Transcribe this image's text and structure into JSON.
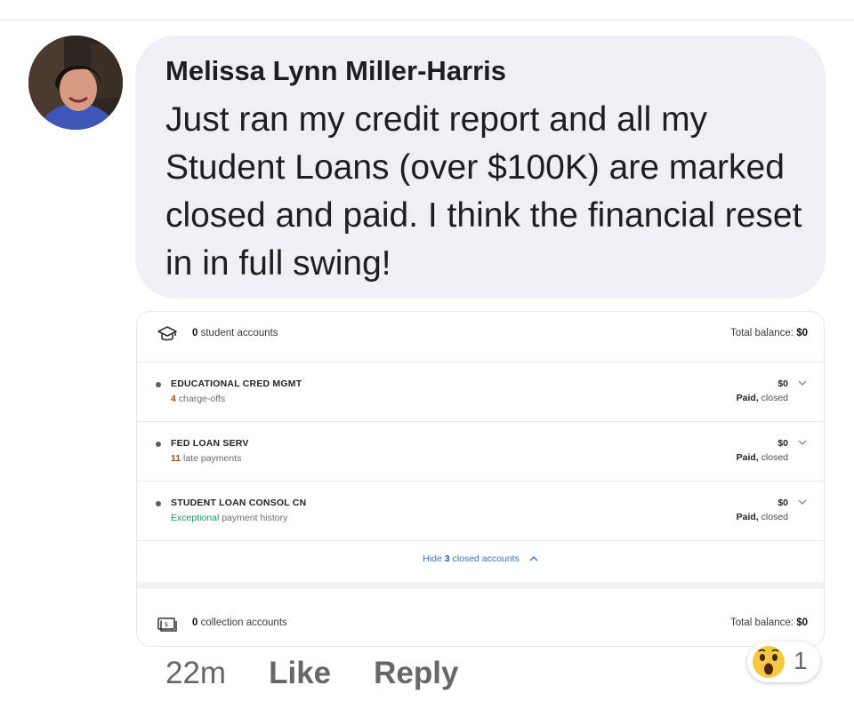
{
  "comment": {
    "author": "Melissa Lynn Miller-Harris",
    "text": "Just ran my credit report and all my Student Loans (over $100K) are marked closed and paid. I think the financial reset in in full swing!",
    "avatar_icon": "profile-photo",
    "actions": {
      "time": "22m",
      "like": "Like",
      "reply": "Reply"
    },
    "reaction": {
      "icon": "wow-emoji-icon",
      "count": "1"
    }
  },
  "report": {
    "student": {
      "icon": "graduation-cap-icon",
      "count": "0",
      "label": "student accounts",
      "total_label": "Total balance:",
      "total_value": "$0"
    },
    "accounts": [
      {
        "name": "EDUCATIONAL CRED MGMT",
        "sub_num": "4",
        "sub_text": "charge-offs",
        "balance": "$0",
        "status_bold": "Paid,",
        "status_text": "closed"
      },
      {
        "name": "FED LOAN SERV",
        "sub_num": "11",
        "sub_text": "late payments",
        "balance": "$0",
        "status_bold": "Paid,",
        "status_text": "closed"
      },
      {
        "name": "STUDENT LOAN CONSOL CN",
        "sub_good": "Exceptional",
        "sub_text": "payment history",
        "balance": "$0",
        "status_bold": "Paid,",
        "status_text": "closed"
      }
    ],
    "hide_link": {
      "prefix": "Hide",
      "count": "3",
      "suffix": "closed accounts"
    },
    "collection": {
      "icon": "money-icon",
      "count": "0",
      "label": "collection accounts",
      "total_label": "Total balance:",
      "total_value": "$0"
    }
  },
  "colors": {
    "bubble": "#efeff5",
    "link": "#3d6fc4",
    "warning": "#b04a12",
    "good": "#1d9a57"
  }
}
